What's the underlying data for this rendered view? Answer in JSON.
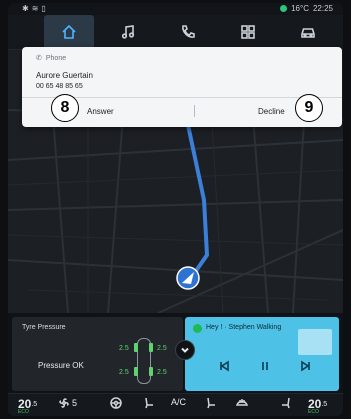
{
  "status": {
    "left_icons": [
      "bluetooth-icon",
      "wifi-icon",
      "phone-link-icon"
    ],
    "temperature": "16°C",
    "time": "22:25"
  },
  "nav": {
    "items": [
      {
        "name": "home",
        "icon": "home-icon",
        "active": true
      },
      {
        "name": "music",
        "icon": "music-icon",
        "active": false
      },
      {
        "name": "phone",
        "icon": "phone-icon",
        "active": false
      },
      {
        "name": "apps",
        "icon": "apps-icon",
        "active": false
      },
      {
        "name": "vehicle",
        "icon": "car-icon",
        "active": false
      }
    ],
    "accent": "#3aa1f2"
  },
  "call": {
    "source_label": "Phone",
    "caller_name": "Aurore Guertain",
    "caller_number": "00 65 48 85 65",
    "answer_label": "Answer",
    "decline_label": "Decline",
    "answer_badge": "8",
    "decline_badge": "9"
  },
  "tyre": {
    "title": "Tyre Pressure",
    "status": "Pressure OK",
    "front_left": "2.5",
    "front_right": "2.5",
    "rear_left": "2.5",
    "rear_right": "2.5",
    "color_ok": "#5fd36f"
  },
  "media": {
    "track": "Hey ! · Stephen Walking",
    "service_icon": "spotify-icon",
    "background": "#4ec1e6"
  },
  "climate": {
    "left_temp": "20",
    "left_temp_decimal": ".5",
    "left_mode": "ECO",
    "fan_speed": "5",
    "ac_label": "A/C",
    "right_temp": "20",
    "right_temp_decimal": ".5",
    "right_mode": "ECO"
  }
}
